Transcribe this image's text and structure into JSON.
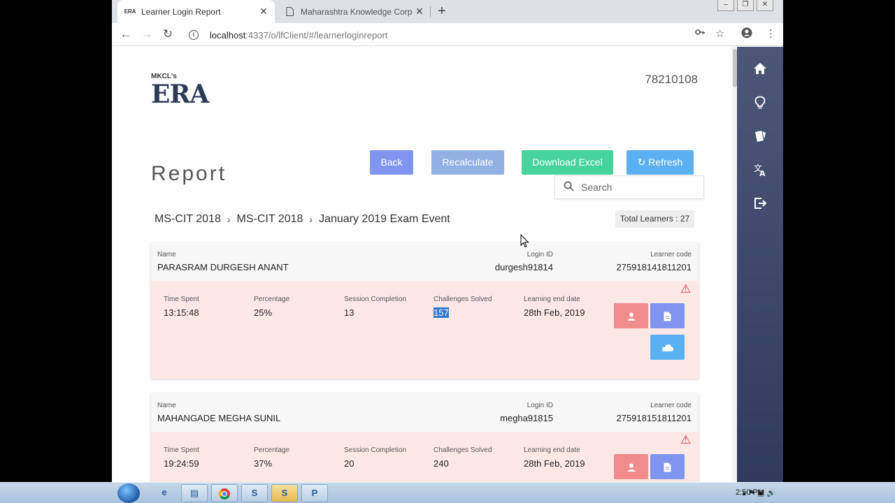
{
  "browser": {
    "tabs": [
      {
        "label": "Learner Login Report",
        "active": true
      },
      {
        "label": "Maharashtra Knowledge Corpora",
        "active": false
      }
    ],
    "url_host": "localhost",
    "url_path": ":4337/o/lfClient/#/learnerloginreport"
  },
  "app": {
    "logo_small": "MKCL's",
    "logo_big": "ERA",
    "user_id": "78210108",
    "page_title": "Report",
    "buttons": {
      "back": "Back",
      "recalculate": "Recalculate",
      "download_excel": "Download Excel",
      "refresh": "Refresh"
    },
    "search_placeholder": "Search",
    "breadcrumb": [
      "MS-CIT 2018",
      "MS-CIT 2018",
      "January 2019 Exam Event"
    ],
    "total_learners": "Total Learners : 27"
  },
  "labels": {
    "name": "Name",
    "login_id": "Login ID",
    "learner_code": "Learner code",
    "time_spent": "Time Spent",
    "percentage": "Percentage",
    "session_completion": "Session Completion",
    "challenges_solved": "Challenges Solved",
    "learning_end_date": "Learning end date"
  },
  "learners": [
    {
      "name": "PARASRAM DURGESH ANANT",
      "login_id": "durgesh91814",
      "learner_code": "275918141811201",
      "time_spent": "13:15:48",
      "percentage": "25%",
      "session_completion": "13",
      "challenges_solved": "157",
      "learning_end_date": "28th Feb, 2019"
    },
    {
      "name": "MAHANGADE MEGHA SUNIL",
      "login_id": "megha91815",
      "learner_code": "275918151811201",
      "time_spent": "19:24:59",
      "percentage": "37%",
      "session_completion": "20",
      "challenges_solved": "240",
      "learning_end_date": "28th Feb, 2019"
    }
  ],
  "taskbar": {
    "clock": "2:50 PM"
  },
  "icons": {
    "sidebar": [
      "home-icon",
      "lightbulb-icon",
      "cards-icon",
      "translate-icon",
      "logout-icon"
    ]
  },
  "colors": {
    "back": "#7f95f0",
    "recalculate": "#93b0e4",
    "download_excel": "#46d39d",
    "refresh": "#5ab0f1",
    "alert_bg": "#fde8e6",
    "sidebar": "#3b4668"
  }
}
